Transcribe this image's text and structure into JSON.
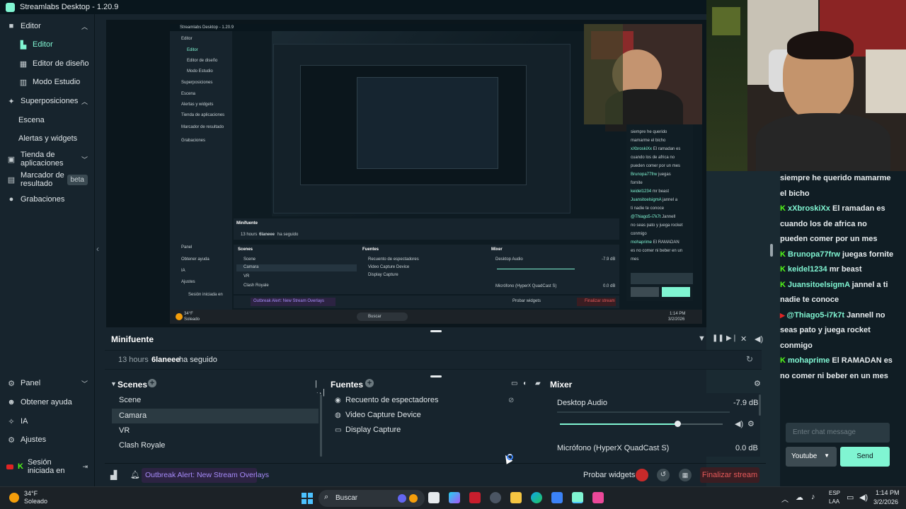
{
  "window": {
    "title": "Streamlabs Desktop - 1.20.9"
  },
  "sidebar": {
    "items": [
      {
        "label": "Editor",
        "icon": "editor-icon"
      },
      {
        "label": "Editor",
        "icon": "editor-tab-icon"
      },
      {
        "label": "Editor de diseño",
        "icon": "layout-icon"
      },
      {
        "label": "Modo Estudio",
        "icon": "studio-icon"
      },
      {
        "label": "Superposiciones",
        "icon": "overlays-icon"
      },
      {
        "label": "Escena"
      },
      {
        "label": "Alertas y widgets"
      },
      {
        "label": "Tienda de aplicaciones",
        "icon": "store-icon"
      },
      {
        "label": "Marcador de resultado",
        "icon": "scoreboard-icon",
        "badge": "beta"
      },
      {
        "label": "Grabaciones",
        "icon": "recordings-icon"
      }
    ],
    "bottom": [
      {
        "label": "Panel",
        "icon": "panel-icon"
      },
      {
        "label": "Obtener ayuda",
        "icon": "help-icon"
      },
      {
        "label": "IA",
        "icon": "ai-icon"
      },
      {
        "label": "Ajustes",
        "icon": "settings-icon"
      },
      {
        "label": "Sesión iniciada en",
        "icon": "youtube-icon"
      }
    ]
  },
  "nested": {
    "title": "Streamlabs Desktop - 1.20.9",
    "minifeed": "Minifuente",
    "feed_time": "13 hours",
    "feed_user": "6laneee",
    "feed_action": "ha seguido",
    "scenes": "Scenes",
    "sources": "Fuentes",
    "mixer": "Mixer",
    "alert": "Outbreak Alert: New Stream Overlays",
    "probar": "Probar widgets",
    "finalizar": "Finalizar stream",
    "search": "Buscar",
    "weather_temp": "34°F",
    "weather_desc": "Soleado",
    "time": "1:14 PM",
    "date": "3/2/2026"
  },
  "minifeed": {
    "title": "Minifuente",
    "entry": {
      "time": "13 hours",
      "user": "6laneee",
      "action": "ha seguido"
    }
  },
  "scenes": {
    "title": "Scenes",
    "items": [
      "Scene",
      "Camara",
      "VR",
      "Clash Royale"
    ],
    "selected": "Camara"
  },
  "sources": {
    "title": "Fuentes",
    "items": [
      "Recuento de espectadores",
      "Video Capture Device",
      "Display Capture"
    ]
  },
  "mixer": {
    "title": "Mixer",
    "tracks": [
      {
        "name": "Desktop Audio",
        "level": "-7.9 dB",
        "fader": 0.72
      },
      {
        "name": "Micrófono (HyperX QuadCast S)",
        "level": "0.0 dB"
      }
    ]
  },
  "footer": {
    "alert": "Outbreak Alert: New Stream Overlays",
    "test_widgets": "Probar widgets",
    "end_stream": "Finalizar stream"
  },
  "chat": {
    "messages": [
      {
        "user": "",
        "text": "siempre he querido mamarme el bicho",
        "platform": "none"
      },
      {
        "user": "xXbroskiXx",
        "text": "El ramadan es cuando los de africa no pueden comer por un mes",
        "platform": "kick"
      },
      {
        "user": "Brunopa77frw",
        "text": "juegas fornite",
        "platform": "kick"
      },
      {
        "user": "keidel1234",
        "text": "mr beast",
        "platform": "kick"
      },
      {
        "user": "JuansitoelsigmA",
        "text": "jannel a ti nadie te conoce",
        "platform": "kick"
      },
      {
        "user": "@Thiago5-i7k7t",
        "text": "Jannell no seas pato y juega rocket conmigo",
        "platform": "youtube"
      },
      {
        "user": "mohaprime",
        "text": "El RAMADAN es no comer ni beber en un mes",
        "platform": "kick"
      }
    ],
    "input_placeholder": "Enter chat message",
    "platform_select": "Youtube",
    "send": "Send"
  },
  "taskbar": {
    "weather_temp": "34°F",
    "weather_desc": "Soleado",
    "search_placeholder": "Buscar",
    "lang_top": "ESP",
    "lang_bottom": "LAA",
    "time": "1:14 PM",
    "date": "3/2/2026"
  },
  "colors": {
    "accent": "#80f5d2",
    "bg": "#17242d",
    "dark": "#09161d",
    "end_stream": "#c82a2a",
    "alert": "#a78bfa"
  }
}
